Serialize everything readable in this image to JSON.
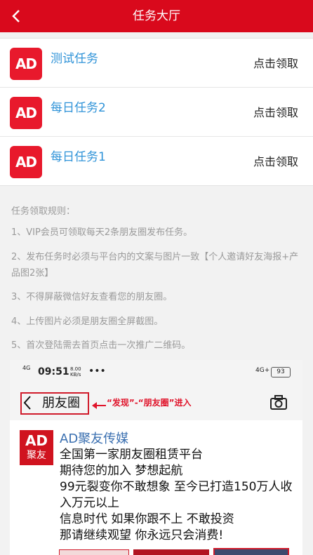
{
  "header": {
    "title": "任务大厅",
    "back_icon": "chevron-left-icon"
  },
  "tasks": [
    {
      "logo": "AD",
      "name": "测试任务",
      "action": "点击领取"
    },
    {
      "logo": "AD",
      "name": "每日任务2",
      "action": "点击领取"
    },
    {
      "logo": "AD",
      "name": "每日任务1",
      "action": "点击领取"
    }
  ],
  "rules": {
    "title": "任务领取规则：",
    "items": [
      "1、VIP会员可领取每天2条朋友圈发布任务。",
      "2、发布任务时必须与平台内的文案与图片一致【个人邀请好友海报+产品图2张】",
      "3、不得屏蔽微信好友查看您的朋友圈。",
      "4、上传图片必须是朋友圈全屏截图。",
      "5、首次登陆需去首页点击一次推广二维码。"
    ]
  },
  "example": {
    "status_signal": "4G",
    "status_time": "09:51",
    "status_speed_value": "8.00",
    "status_speed_unit": "KB/s",
    "status_dots": "•••",
    "status_network": "4G+",
    "status_battery": "93",
    "moments_title": "朋友圈",
    "annotation": "“发现”-“朋友圈”进入",
    "post_logo_top": "AD",
    "post_logo_bottom": "聚友",
    "post_name": "AD聚友传媒",
    "post_lines": [
      "全国第一家朋友圈租赁平台",
      "期待您的加入 梦想起航",
      "99元裂变你不敢想象  至今已打造150万人收入万元以上",
      "信息时代 如果你跟不上 不敢投资",
      "那请继续观望 你永远只会消费!"
    ]
  },
  "colors": {
    "header": "#d9091c",
    "task_name": "#2f93d8",
    "logo": "#e8192c",
    "rule_text": "#9a9a9a"
  }
}
